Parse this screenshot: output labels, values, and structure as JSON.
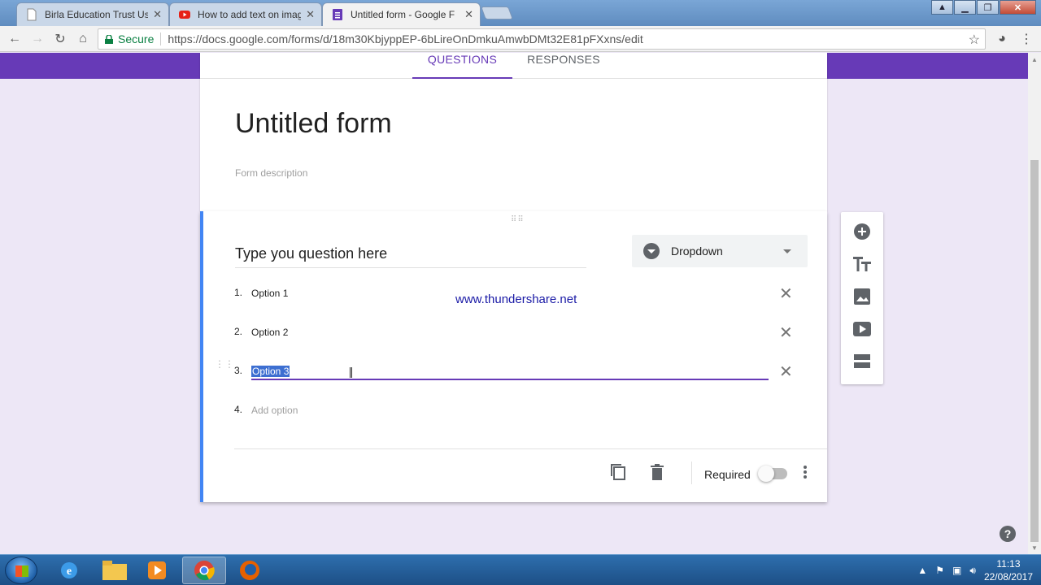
{
  "browser": {
    "tabs": [
      {
        "title": "Birla Education Trust Use",
        "active": false,
        "icon": "doc-icon"
      },
      {
        "title": "How to add text on imag",
        "active": false,
        "icon": "youtube-icon"
      },
      {
        "title": "Untitled form - Google F",
        "active": true,
        "icon": "google-forms-icon"
      }
    ],
    "secure_label": "Secure",
    "url": "https://docs.google.com/forms/d/18m30KbjyppEP-6bLireOnDmkuAmwbDMt32E81pFXxns/edit"
  },
  "form": {
    "tabs": {
      "questions": "QUESTIONS",
      "responses": "RESPONSES"
    },
    "title": "Untitled form",
    "description_placeholder": "Form description"
  },
  "question": {
    "text": "Type you question here",
    "type": "Dropdown",
    "options": [
      {
        "num": "1.",
        "label": "Option 1"
      },
      {
        "num": "2.",
        "label": "Option 2"
      },
      {
        "num": "3.",
        "label": "Option 3",
        "selected": true
      }
    ],
    "add_option": {
      "num": "4.",
      "label": "Add option"
    },
    "required_label": "Required",
    "required": false
  },
  "watermark": "www.thundershare.net",
  "taskbar": {
    "time": "11:13",
    "date": "22/08/2017"
  },
  "colors": {
    "accent": "#673ab7",
    "page_bg": "#ede7f6",
    "focus_border": "#4285f4"
  }
}
